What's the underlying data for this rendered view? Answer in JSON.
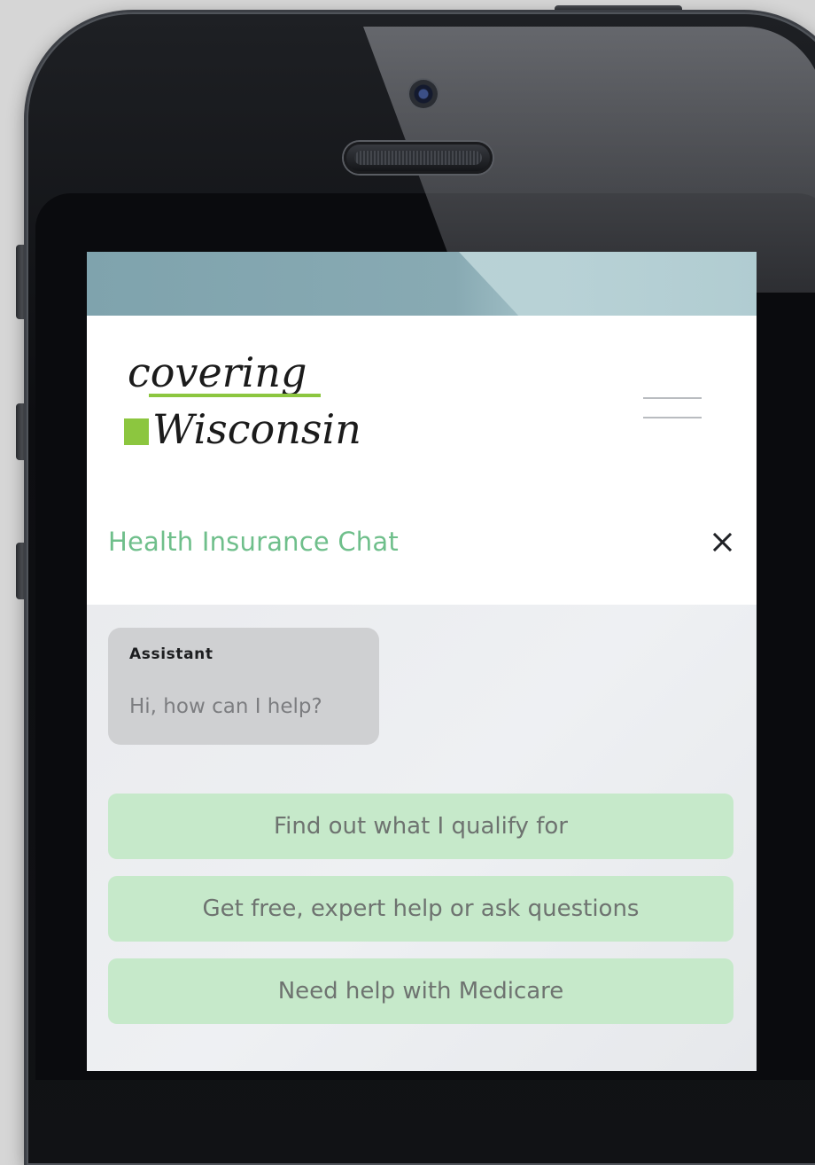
{
  "site": {
    "logo_line1": "covering",
    "logo_line2": "Wisconsin"
  },
  "chat": {
    "title": "Health Insurance Chat",
    "close_symbol": "✕",
    "message": {
      "sender": "Assistant",
      "text": "Hi, how can I help?"
    },
    "options": [
      {
        "label": "Find out what I qualify for"
      },
      {
        "label": "Get free, expert help or ask questions"
      },
      {
        "label": "Need help with Medicare"
      }
    ]
  },
  "colors": {
    "accent_green": "#6fbf8b",
    "logo_green": "#8cc63f",
    "option_bg": "#c6e9ca",
    "bubble_bg": "#cfd0d2"
  },
  "icons": [
    "hamburger-menu-icon",
    "close-icon",
    "camera-icon",
    "speaker-grille-icon"
  ]
}
